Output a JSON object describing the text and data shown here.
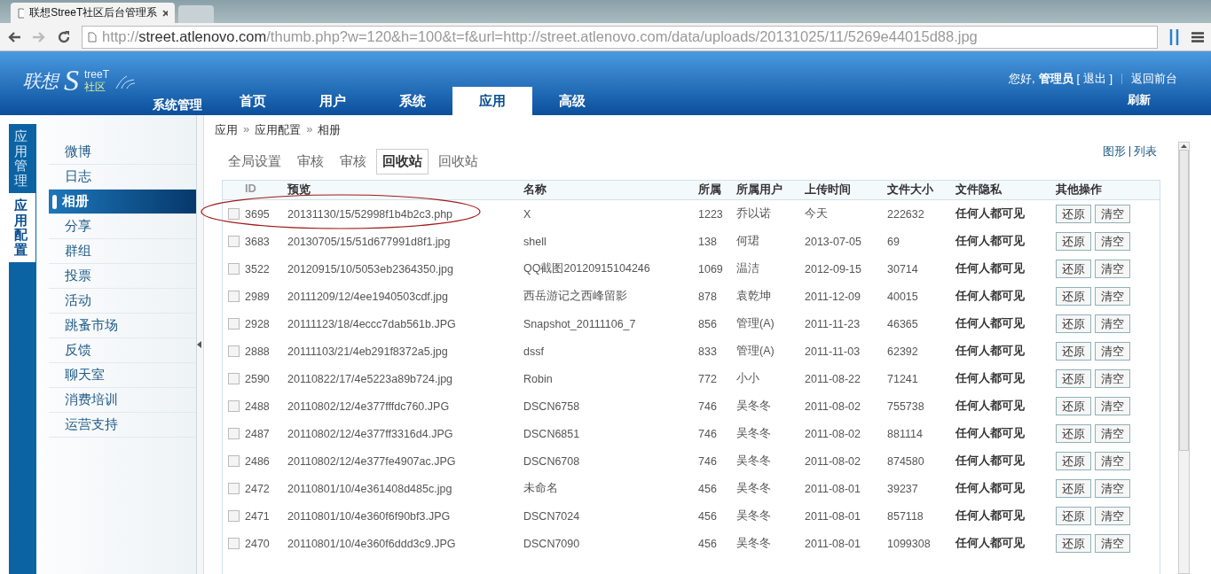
{
  "browser": {
    "tab_title": "联想StreeT社区后台管理系",
    "url_prefix": "http://",
    "url_host": "street.atlenovo.com",
    "url_rest": "/thumb.php?w=120&h=100&t=f&url=http://street.atlenovo.com/data/uploads/20131025/11/5269e44015d88.jpg"
  },
  "header": {
    "logo": {
      "brand": "联想",
      "mark": "S",
      "top": "treeT",
      "bottom": "社区"
    },
    "section_title": "系统管理",
    "nav": [
      {
        "label": "首页",
        "selected": false
      },
      {
        "label": "用户",
        "selected": false
      },
      {
        "label": "系统",
        "selected": false
      },
      {
        "label": "应用",
        "selected": true
      },
      {
        "label": "高级",
        "selected": false
      }
    ],
    "user_bar": {
      "greeting": "您好,",
      "name": "管理员",
      "logout": "[ 退出 ]",
      "back": "返回前台",
      "refresh": "刷新"
    }
  },
  "sidebar": {
    "groups": [
      {
        "label": "应用管理",
        "selected": false
      },
      {
        "label": "应用配置",
        "selected": true
      }
    ],
    "items": [
      {
        "label": "微博",
        "selected": false
      },
      {
        "label": "日志",
        "selected": false
      },
      {
        "label": "相册",
        "selected": true
      },
      {
        "label": "分享",
        "selected": false
      },
      {
        "label": "群组",
        "selected": false
      },
      {
        "label": "投票",
        "selected": false
      },
      {
        "label": "活动",
        "selected": false
      },
      {
        "label": "跳蚤市场",
        "selected": false
      },
      {
        "label": "反馈",
        "selected": false
      },
      {
        "label": "聊天室",
        "selected": false
      },
      {
        "label": "消费培训",
        "selected": false
      },
      {
        "label": "运营支持",
        "selected": false
      }
    ]
  },
  "breadcrumb": {
    "separator": "»",
    "items": [
      "应用",
      "应用配置",
      "相册"
    ]
  },
  "subtabs": [
    {
      "label": "全局设置",
      "selected": false
    },
    {
      "label": "审核",
      "selected": false
    },
    {
      "label": "审核",
      "selected": false
    },
    {
      "label": "回收站",
      "selected": true
    },
    {
      "label": "回收站",
      "selected": false
    }
  ],
  "view_links": [
    "图形",
    "列表"
  ],
  "table": {
    "columns": [
      "ID",
      "预览",
      "名称",
      "所属",
      "所属用户",
      "上传时间",
      "文件大小",
      "文件隐私",
      "其他操作"
    ],
    "rows": [
      {
        "checked": false,
        "cells": [
          "3695",
          "20131130/15/52998f1b4b2c3.php",
          "X",
          "1223",
          "乔以诺",
          "今天",
          "222632",
          "任何人都可见"
        ],
        "actions": [
          "还原",
          "清空"
        ]
      },
      {
        "checked": false,
        "cells": [
          "3683",
          "20130705/15/51d677991d8f1.jpg",
          "shell",
          "138",
          "何珺",
          "2013-07-05",
          "69",
          "任何人都可见"
        ],
        "actions": [
          "还原",
          "清空"
        ]
      },
      {
        "checked": false,
        "cells": [
          "3522",
          "20120915/10/5053eb2364350.jpg",
          "QQ截图20120915104246",
          "1069",
          "温洁",
          "2012-09-15",
          "30714",
          "任何人都可见"
        ],
        "actions": [
          "还原",
          "清空"
        ]
      },
      {
        "checked": false,
        "cells": [
          "2989",
          "20111209/12/4ee1940503cdf.jpg",
          "西岳游记之西峰留影",
          "878",
          "袁乾坤",
          "2011-12-09",
          "40015",
          "任何人都可见"
        ],
        "actions": [
          "还原",
          "清空"
        ]
      },
      {
        "checked": false,
        "cells": [
          "2928",
          "20111123/18/4eccc7dab561b.JPG",
          "Snapshot_20111106_7",
          "856",
          "管理(A)",
          "2011-11-23",
          "46365",
          "任何人都可见"
        ],
        "actions": [
          "还原",
          "清空"
        ]
      },
      {
        "checked": false,
        "cells": [
          "2888",
          "20111103/21/4eb291f8372a5.jpg",
          "dssf",
          "833",
          "管理(A)",
          "2011-11-03",
          "62392",
          "任何人都可见"
        ],
        "actions": [
          "还原",
          "清空"
        ]
      },
      {
        "checked": false,
        "cells": [
          "2590",
          "20110822/17/4e5223a89b724.jpg",
          "Robin",
          "772",
          "小小",
          "2011-08-22",
          "71241",
          "任何人都可见"
        ],
        "actions": [
          "还原",
          "清空"
        ]
      },
      {
        "checked": false,
        "cells": [
          "2488",
          "20110802/12/4e377fffdc760.JPG",
          "DSCN6758",
          "746",
          "吴冬冬",
          "2011-08-02",
          "755738",
          "任何人都可见"
        ],
        "actions": [
          "还原",
          "清空"
        ]
      },
      {
        "checked": false,
        "cells": [
          "2487",
          "20110802/12/4e377ff3316d4.JPG",
          "DSCN6851",
          "746",
          "吴冬冬",
          "2011-08-02",
          "881114",
          "任何人都可见"
        ],
        "actions": [
          "还原",
          "清空"
        ]
      },
      {
        "checked": false,
        "cells": [
          "2486",
          "20110802/12/4e377fe4907ac.JPG",
          "DSCN6708",
          "746",
          "吴冬冬",
          "2011-08-02",
          "874580",
          "任何人都可见"
        ],
        "actions": [
          "还原",
          "清空"
        ]
      },
      {
        "checked": false,
        "cells": [
          "2472",
          "20110801/10/4e361408d485c.jpg",
          "未命名",
          "456",
          "吴冬冬",
          "2011-08-01",
          "39237",
          "任何人都可见"
        ],
        "actions": [
          "还原",
          "清空"
        ]
      },
      {
        "checked": false,
        "cells": [
          "2471",
          "20110801/10/4e360f6f90bf3.JPG",
          "DSCN7024",
          "456",
          "吴冬冬",
          "2011-08-01",
          "857118",
          "任何人都可见"
        ],
        "actions": [
          "还原",
          "清空"
        ]
      },
      {
        "checked": false,
        "cells": [
          "2470",
          "20110801/10/4e360f6ddd3c9.JPG",
          "DSCN7090",
          "456",
          "吴冬冬",
          "2011-08-01",
          "1099308",
          "任何人都可见"
        ],
        "actions": [
          "还原",
          "清空"
        ]
      }
    ]
  }
}
